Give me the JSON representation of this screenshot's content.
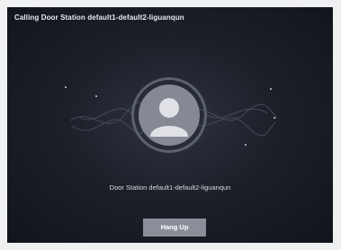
{
  "dialog": {
    "title": "Calling Door Station default1-default2-liguanqun",
    "station_name": "Door Station default1-default2-liguanqun",
    "hangup_label": "Hang Up",
    "avatar_icon": "person-avatar-icon"
  },
  "colors": {
    "background": "#1d2029",
    "avatar": "#858994",
    "button": "#8a8e98",
    "text": "#e8eaee"
  }
}
